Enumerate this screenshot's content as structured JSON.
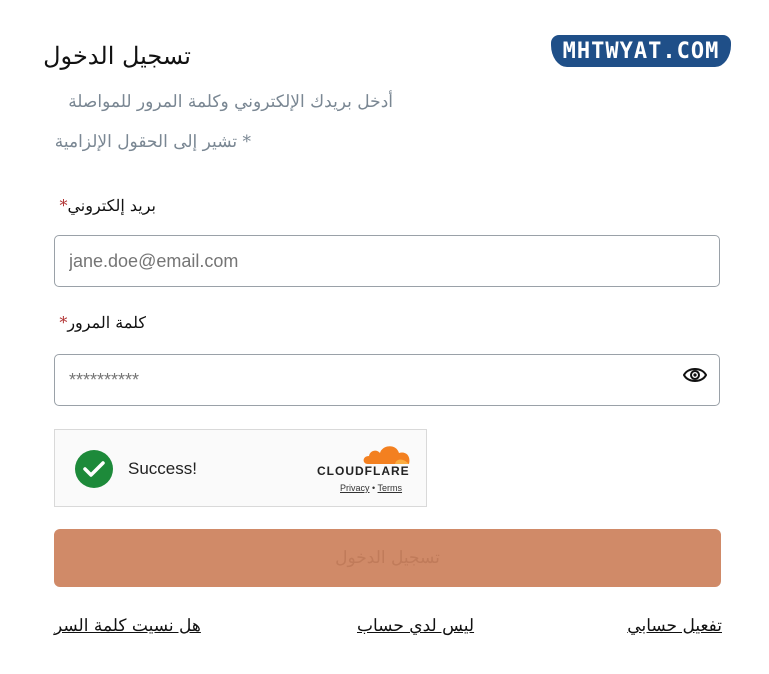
{
  "logo": {
    "text": "MHTWYAT.COM"
  },
  "header": {
    "title": "تسجيل الدخول",
    "subtitle": "أدخل بريدك الإلكتروني وكلمة المرور للمواصلة",
    "required_note": "* تشير إلى الحقول الإلزامية"
  },
  "form": {
    "email_label": "بريد إلكتروني",
    "email_placeholder": "jane.doe@email.com",
    "password_label": "كلمة المرور",
    "password_placeholder": "**********",
    "required_star": "*",
    "submit_label": "تسجيل الدخول"
  },
  "captcha": {
    "status": "Success!",
    "brand": "CLOUDFLARE",
    "privacy": "Privacy",
    "separator": "•",
    "terms": "Terms",
    "success_color": "#1d8a3a",
    "brand_color": "#f38020"
  },
  "links": {
    "forgot": "هل نسيت كلمة السر",
    "no_account": "ليس لدي حساب",
    "activate": "تفعيل حسابي"
  },
  "colors": {
    "logo_bg": "#1f4f88",
    "submit_bg": "#d08a68",
    "muted_text": "#7a8793"
  }
}
